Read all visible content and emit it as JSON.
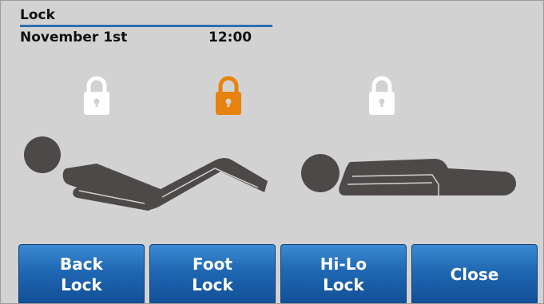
{
  "header": {
    "title": "Lock",
    "date": "November 1st",
    "time": "12:00"
  },
  "locks": [
    {
      "name": "back-lock-indicator",
      "color": "#ffffff",
      "icon": "padlock-icon"
    },
    {
      "name": "foot-lock-indicator",
      "color": "#e8820e",
      "icon": "padlock-icon"
    },
    {
      "name": "hilo-lock-indicator",
      "color": "#ffffff",
      "icon": "padlock-icon"
    }
  ],
  "colors": {
    "background": "#d3d2d2",
    "figure": "#4d4948",
    "accent_line": "#2f6fb0",
    "active_lock": "#e8820e",
    "button": "#1f67b2"
  },
  "buttons": {
    "back_lock": {
      "line1": "Back",
      "line2": "Lock"
    },
    "foot_lock": {
      "line1": "Foot",
      "line2": "Lock"
    },
    "hilo_lock": {
      "line1": "Hi-Lo",
      "line2": "Lock"
    },
    "close": {
      "label": "Close"
    }
  }
}
